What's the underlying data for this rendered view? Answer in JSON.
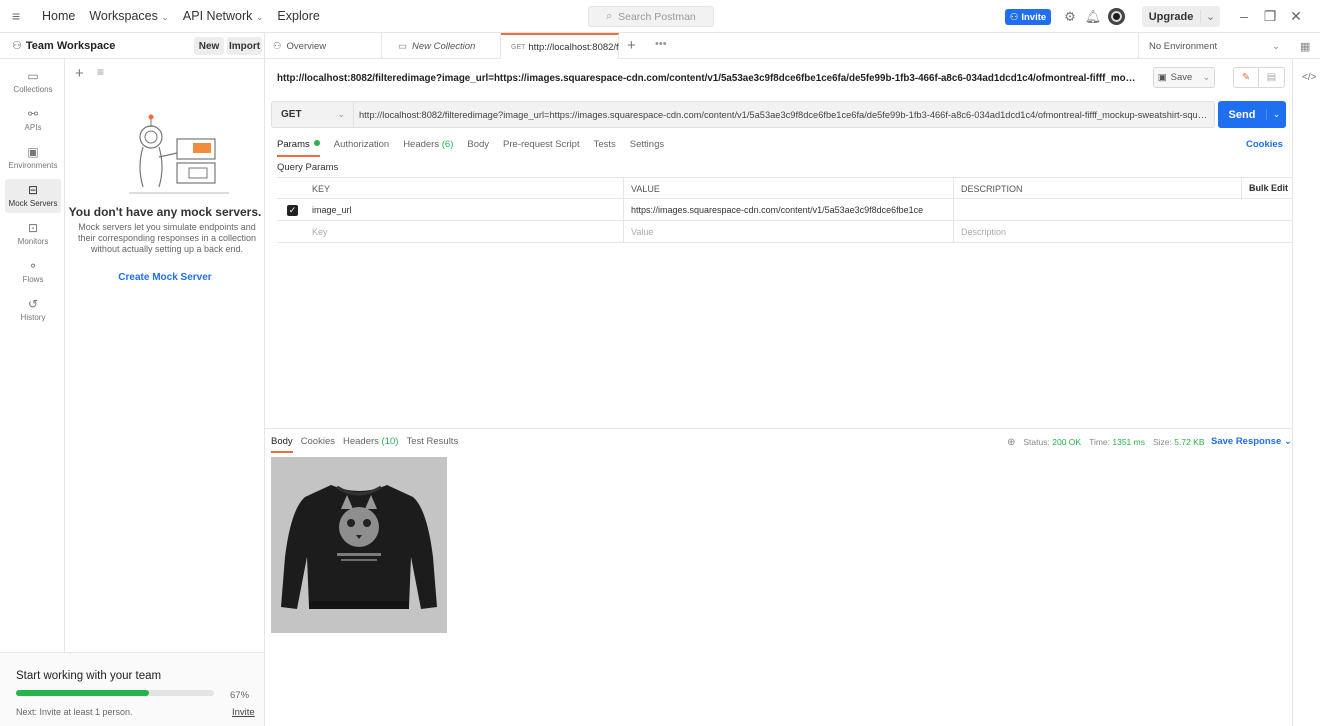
{
  "topbar": {
    "nav": [
      "Home",
      "Workspaces",
      "API Network",
      "Explore"
    ],
    "search_placeholder": "Search Postman",
    "invite": "Invite",
    "upgrade": "Upgrade"
  },
  "workspace": {
    "name": "Team Workspace",
    "new_label": "New",
    "import_label": "Import"
  },
  "rail": [
    {
      "label": "Collections",
      "icon": "collections-icon"
    },
    {
      "label": "APIs",
      "icon": "apis-icon"
    },
    {
      "label": "Environments",
      "icon": "environments-icon"
    },
    {
      "label": "Mock Servers",
      "icon": "mock-servers-icon",
      "active": true
    },
    {
      "label": "Monitors",
      "icon": "monitors-icon"
    },
    {
      "label": "Flows",
      "icon": "flows-icon"
    },
    {
      "label": "History",
      "icon": "history-icon"
    }
  ],
  "mock_panel": {
    "title": "You don't have any mock servers.",
    "description": "Mock servers let you simulate endpoints and their corresponding responses in a collection without actually setting up a back end.",
    "create_label": "Create Mock Server"
  },
  "team": {
    "title": "Start working with your team",
    "progress_percent": 67,
    "progress_label": "67%",
    "next": "Next: Invite at least 1 person.",
    "invite_link": "Invite"
  },
  "tabs": {
    "overview": "Overview",
    "new_collection": "New Collection",
    "active_method": "GET",
    "active_label": "http://localhost:8082/f",
    "more": "•••",
    "environment": "No Environment"
  },
  "request": {
    "title": "http://localhost:8082/filteredimage?image_url=https://images.squarespace-cdn.com/content/v1/5a53ae3c9f8dce6fbe1ce6fa/de5fe99b-1fb3-466f-a8c6-034ad1dcd1c4/ofmontreal-fifff_mockup-sweatshirt-sq...",
    "save_label": "Save",
    "method": "GET",
    "url": "http://localhost:8082/filteredimage?image_url=https://images.squarespace-cdn.com/content/v1/5a53ae3c9f8dce6fbe1ce6fa/de5fe99b-1fb3-466f-a8c6-034ad1dcd1c4/ofmontreal-fifff_mockup-sweatshirt-square.jp...",
    "send_label": "Send",
    "tabs": {
      "params": "Params",
      "authorization": "Authorization",
      "headers": "Headers",
      "headers_count": "(6)",
      "body": "Body",
      "prerequest": "Pre-request Script",
      "tests": "Tests",
      "settings": "Settings"
    },
    "cookies_label": "Cookies",
    "query_params_label": "Query Params",
    "params_table": {
      "headers": {
        "key": "KEY",
        "value": "VALUE",
        "description": "DESCRIPTION",
        "more": "•••",
        "bulk_edit": "Bulk Edit"
      },
      "row": {
        "key": "image_url",
        "value": "https://images.squarespace-cdn.com/content/v1/5a53ae3c9f8dce6fbe1ce"
      },
      "placeholders": {
        "key": "Key",
        "value": "Value",
        "description": "Description"
      }
    }
  },
  "response": {
    "tabs": {
      "body": "Body",
      "cookies": "Cookies",
      "headers": "Headers",
      "headers_count": "(10)",
      "test_results": "Test Results"
    },
    "status_label": "Status:",
    "status_value": "200 OK",
    "time_label": "Time:",
    "time_value": "1351 ms",
    "size_label": "Size:",
    "size_value": "5.72 KB",
    "save_response": "Save Response"
  }
}
